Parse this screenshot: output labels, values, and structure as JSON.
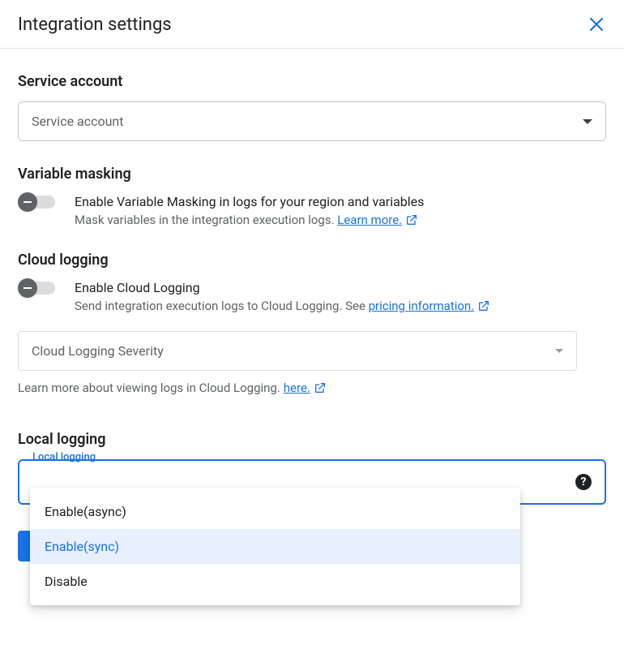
{
  "header": {
    "title": "Integration settings"
  },
  "service": {
    "section_title": "Service account",
    "placeholder": "Service account"
  },
  "masking": {
    "section_title": "Variable masking",
    "toggle_label": "Enable Variable Masking in logs for your region and variables",
    "toggle_desc": "Mask variables in the integration execution logs. ",
    "learn_more": "Learn more."
  },
  "cloud": {
    "section_title": "Cloud logging",
    "toggle_label": "Enable Cloud Logging",
    "toggle_desc_prefix": "Send integration execution logs to Cloud Logging. See ",
    "pricing_link": "pricing information.",
    "severity_placeholder": "Cloud Logging Severity",
    "severity_help_prefix": "Learn more about viewing logs in Cloud Logging. ",
    "severity_help_link": "here."
  },
  "local": {
    "section_title": "Local logging",
    "field_legend": "Local logging",
    "options": [
      "Enable(async)",
      "Enable(sync)",
      "Disable"
    ],
    "selected_index": 1
  }
}
